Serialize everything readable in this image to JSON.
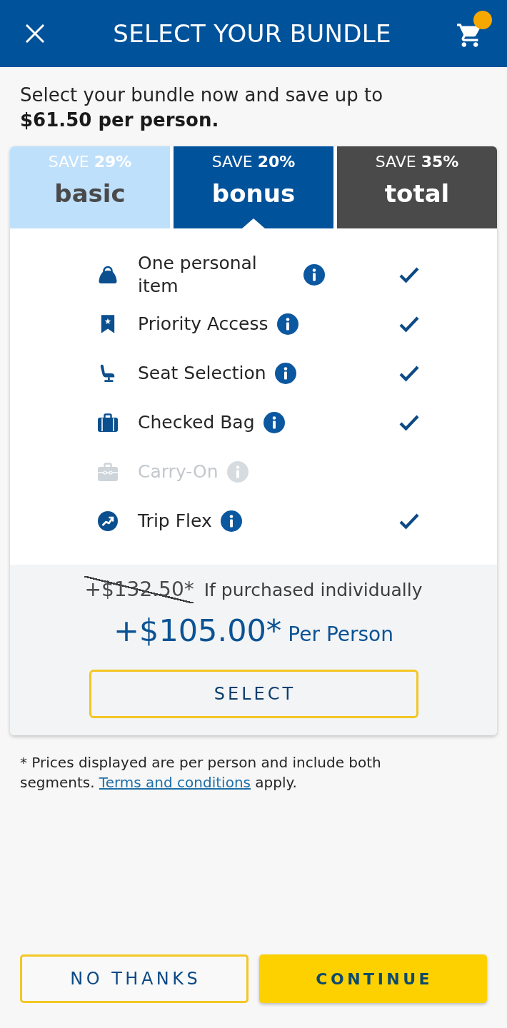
{
  "header": {
    "title": "SELECT YOUR BUNDLE",
    "cart_badge": true
  },
  "intro": "Select your bundle now and save up to **$61.50 per person.**",
  "tabs": [
    {
      "save": "SAVE **29%**",
      "name": "basic",
      "color": "#bfe0fb",
      "selected": false
    },
    {
      "save": "SAVE **20%**",
      "name": "bonus",
      "color": "#00529b",
      "selected": true
    },
    {
      "save": "SAVE **35%**",
      "name": "total",
      "color": "#4a4a4a",
      "selected": false
    }
  ],
  "features": [
    {
      "label": "One personal item",
      "included": true,
      "disabled": false
    },
    {
      "label": "Priority Access",
      "included": true,
      "disabled": false
    },
    {
      "label": "Seat Selection",
      "included": true,
      "disabled": false
    },
    {
      "label": "Checked Bag",
      "included": true,
      "disabled": false
    },
    {
      "label": "Carry-On",
      "included": false,
      "disabled": true
    },
    {
      "label": "Trip Flex",
      "included": true,
      "disabled": false
    }
  ],
  "pricing": {
    "original_price": "+$132.50*",
    "original_note": "If purchased individually",
    "price": "+$105.00*",
    "price_unit": "Per Person",
    "select_button": "SELECT"
  },
  "footnote": {
    "text": "* Prices displayed are per person and include both segments.",
    "link": "Terms and conditions",
    "text_after": "apply."
  },
  "actions": [
    {
      "label": "NO THANKS",
      "kind": "secondary"
    },
    {
      "label": "CONTINUE",
      "kind": "primary"
    }
  ]
}
